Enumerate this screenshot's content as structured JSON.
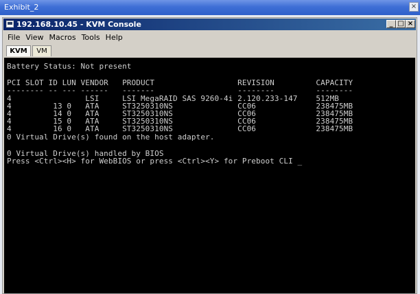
{
  "outer_window": {
    "title": "Exhibit_2",
    "close_glyph": "×"
  },
  "window": {
    "title": "192.168.10.45 - KVM Console",
    "controls": {
      "minimize": "_",
      "maximize": "□",
      "close": "×"
    }
  },
  "menu": [
    "File",
    "View",
    "Macros",
    "Tools",
    "Help"
  ],
  "tabs": [
    {
      "label": "KVM",
      "active": true
    },
    {
      "label": "VM",
      "active": false
    }
  ],
  "console": {
    "lines": [
      "Battery Status: Not present",
      "",
      "PCI SLOT ID LUN VENDOR   PRODUCT                  REVISION         CAPACITY",
      "-------- -- --- ------   -------                  --------         --------",
      "4                LSI     LSI MegaRAID SAS 9260-4i 2.120.233-147    512MB",
      "4         13 0   ATA     ST3250310NS              CC06             238475MB",
      "4         14 0   ATA     ST3250310NS              CC06             238475MB",
      "4         15 0   ATA     ST3250310NS              CC06             238475MB",
      "4         16 0   ATA     ST3250310NS              CC06             238475MB",
      "0 Virtual Drive(s) found on the host adapter.",
      "",
      "0 Virtual Drive(s) handled by BIOS",
      "Press <Ctrl><H> for WebBIOS or press <Ctrl><Y> for Preboot CLI _"
    ]
  }
}
